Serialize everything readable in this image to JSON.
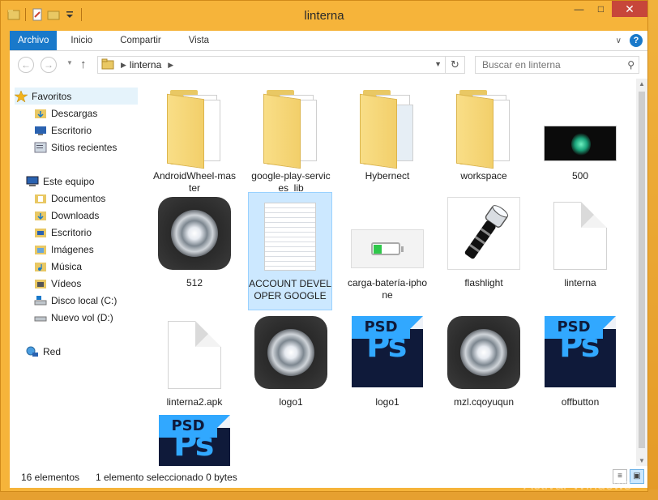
{
  "window": {
    "title": "linterna"
  },
  "ribbon": {
    "tabs": [
      "Archivo",
      "Inicio",
      "Compartir",
      "Vista"
    ]
  },
  "address": {
    "crumb": "linterna",
    "search_placeholder": "Buscar en linterna"
  },
  "nav": {
    "favorites": {
      "label": "Favoritos",
      "items": [
        "Descargas",
        "Escritorio",
        "Sitios recientes"
      ]
    },
    "computer": {
      "label": "Este equipo",
      "items": [
        "Documentos",
        "Downloads",
        "Escritorio",
        "Imágenes",
        "Música",
        "Vídeos",
        "Disco local (C:)",
        "Nuevo vol (D:)"
      ]
    },
    "network": {
      "label": "Red"
    }
  },
  "files": [
    {
      "name": "AndroidWheel-master",
      "kind": "folder"
    },
    {
      "name": "google-play-services_lib",
      "kind": "folder"
    },
    {
      "name": "Hybernect",
      "kind": "folder"
    },
    {
      "name": "workspace",
      "kind": "folder"
    },
    {
      "name": "500",
      "kind": "image-lamp-wide"
    },
    {
      "name": "512",
      "kind": "image-lamp"
    },
    {
      "name": "ACCOUNT DEVELOPER GOOGLE",
      "kind": "text",
      "selected": true
    },
    {
      "name": "carga-batería-iphone",
      "kind": "image-battery"
    },
    {
      "name": "flashlight",
      "kind": "image-flashlight"
    },
    {
      "name": "linterna",
      "kind": "blank"
    },
    {
      "name": "linterna2.apk",
      "kind": "blank"
    },
    {
      "name": "logo1",
      "kind": "image-lamp"
    },
    {
      "name": "logo1",
      "kind": "psd"
    },
    {
      "name": "mzl.cqoyuqun",
      "kind": "image-lamp"
    },
    {
      "name": "offbutton",
      "kind": "psd"
    },
    {
      "name": "",
      "kind": "psd"
    }
  ],
  "psd_label": "PSD",
  "ps_label": "Ps",
  "status": {
    "count": "16 elementos",
    "selection": "1 elemento seleccionado  0 bytes"
  },
  "watermark": "Activar Windows",
  "colors": {
    "accent": "#1979ca",
    "title_bar": "#f6b43a",
    "selection": "#cce8ff"
  }
}
